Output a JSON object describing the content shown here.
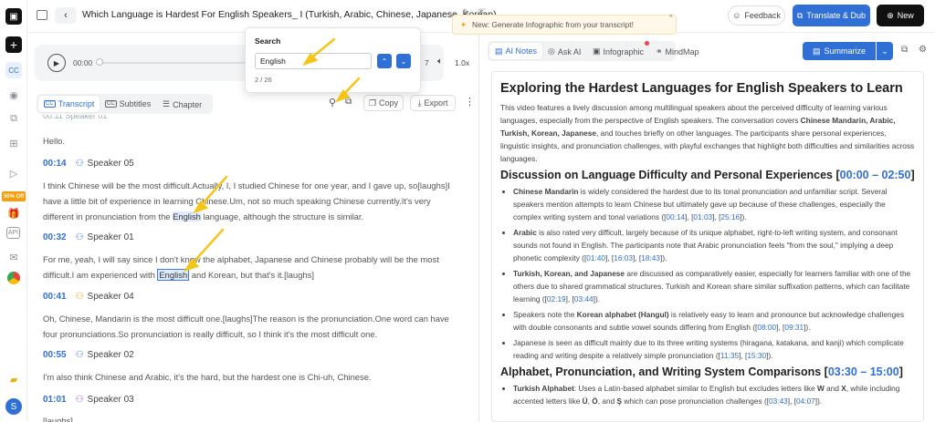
{
  "topbar": {
    "title": "Which Language is Hardest For English Speakers_ I (Turkish, Arabic, Chinese, Japanese, Korean)",
    "feedback": "Feedback",
    "translate": "Translate & Dub",
    "new": "New",
    "banner": "New: Generate Infographic from your transcript!"
  },
  "sidebar": {
    "promo": "50% Off",
    "avatar": "S"
  },
  "player": {
    "time": "00:00",
    "speed": "1.0x",
    "partial_digit": "7"
  },
  "search": {
    "title": "Search",
    "value": "English",
    "count": "2 / 26"
  },
  "left_tabs": {
    "transcript": "Transcript",
    "subtitles": "Subtitles",
    "chapter": "Chapter",
    "copy": "Copy",
    "export": "Export"
  },
  "transcript": [
    {
      "time": "00:14",
      "speaker": "Speaker 05",
      "color": "#3b82f6"
    },
    {
      "time": "00:32",
      "speaker": "Speaker 01",
      "color": "#3b82f6"
    },
    {
      "time": "00:41",
      "speaker": "Speaker 04",
      "color": "#f59e0b"
    },
    {
      "time": "00:55",
      "speaker": "Speaker 02",
      "color": "#3b82f6"
    },
    {
      "time": "01:01",
      "speaker": "Speaker 03",
      "color": "#a855f7"
    }
  ],
  "transcript_text": {
    "hello": "Hello.",
    "p1a": "I think Chinese will be the most difficult.Actually, I, I studied Chinese for one year, and I gave up, so[laughs]I have a little bit of experience in learning Chinese.Um, not so much speaking Chinese currently.It's very different in pronunciation from the ",
    "p1hl": "English",
    "p1b": " language, although the structure is similar.",
    "p2a": "For me, yeah, I will say since I don't know the alphabet, Japanese and Chinese probably will be the most difficult.I am experienced with ",
    "p2hl": "English",
    "p2b": " and Korean, but that's it.[laughs]",
    "p3": "Oh, Chinese, Mandarin is the most difficult one.[laughs]The reason is the pronunciation.One word can have four pronunciations.So pronunciation is really difficult, so I think it's the most difficult one.",
    "p4": "I'm also think Chinese and Arabic, it's the hard, but the hardest one is Chi-uh, Chinese.",
    "p5": "[laughs]",
    "top_cut": "00:11    Speaker 01"
  },
  "right_tabs": {
    "ai_notes": "AI Notes",
    "ask_ai": "Ask AI",
    "infographic": "Infographic",
    "mindmap": "MindMap",
    "summarize": "Summarize"
  },
  "notes": {
    "title": "Exploring the Hardest Languages for English Speakers to Learn",
    "intro_a": "This video features a lively discussion among multilingual speakers about the perceived difficulty of learning various languages, especially from the perspective of English speakers. The conversation covers ",
    "intro_b": "Chinese Mandarin, Arabic, Turkish, Korean, Japanese",
    "intro_c": ", and touches briefly on other languages. The participants share personal experiences, linguistic insights, and pronunciation challenges, with playful exchanges that highlight both difficulties and similarities across languages.",
    "h2a": "Discussion on Language Difficulty and Personal Experiences",
    "h2a_range": "00:00 – 02:50",
    "b1_bold": "Chinese Mandarin",
    "b1": " is widely considered the hardest due to its tonal pronunciation and unfamiliar script. Several speakers mention attempts to learn Chinese but ultimately gave up because of these challenges, especially the complex writing system and tonal variations (",
    "b1_refs": [
      "00:14",
      "01:03",
      "25:16"
    ],
    "b2_bold": "Arabic",
    "b2": " is also rated very difficult, largely because of its unique alphabet, right-to-left writing system, and consonant sounds not found in English. The participants note that Arabic pronunciation feels \"from the soul,\" implying a deep phonetic complexity (",
    "b2_refs": [
      "01:40",
      "16:03",
      "18:43"
    ],
    "b3_bold": "Turkish, Korean, and Japanese",
    "b3": " are discussed as comparatively easier, especially for learners familiar with one of the others due to shared grammatical structures. Turkish and Korean share similar suffixation patterns, which can facilitate learning (",
    "b3_refs": [
      "02:19",
      "03:44"
    ],
    "b4a": "Speakers note the ",
    "b4_bold": "Korean alphabet (Hangul)",
    "b4b": " is relatively easy to learn and pronounce but acknowledge challenges with double consonants and subtle vowel sounds differing from English (",
    "b4_refs": [
      "08:00",
      "09:31"
    ],
    "b5": "Japanese is seen as difficult mainly due to its three writing systems (hiragana, katakana, and kanji) which complicate reading and writing despite a relatively simple pronunciation (",
    "b5_refs": [
      "11:35",
      "15:30"
    ],
    "h2b": "Alphabet, Pronunciation, and Writing System Comparisons",
    "h2b_range": "03:30 – 15:00",
    "b6_bold": "Turkish Alphabet",
    "b6a": ": Uses a Latin-based alphabet similar to English but excludes letters like ",
    "b6_w": "W",
    "b6_and": " and ",
    "b6_x": "X",
    "b6b": ", while including accented letters like ",
    "b6_u": "Ü",
    "b6_c": ", ",
    "b6_o": "Ö",
    "b6_and2": ", and ",
    "b6_s": "Ş",
    "b6c": " which can pose pronunciation challenges (",
    "b6_refs": [
      "03:43",
      "04:07"
    ]
  },
  "colors": {
    "accent": "#2f6fd6",
    "highlight": "#e0ebff",
    "arrow": "#f5c518",
    "promo": "#f59e0b"
  }
}
